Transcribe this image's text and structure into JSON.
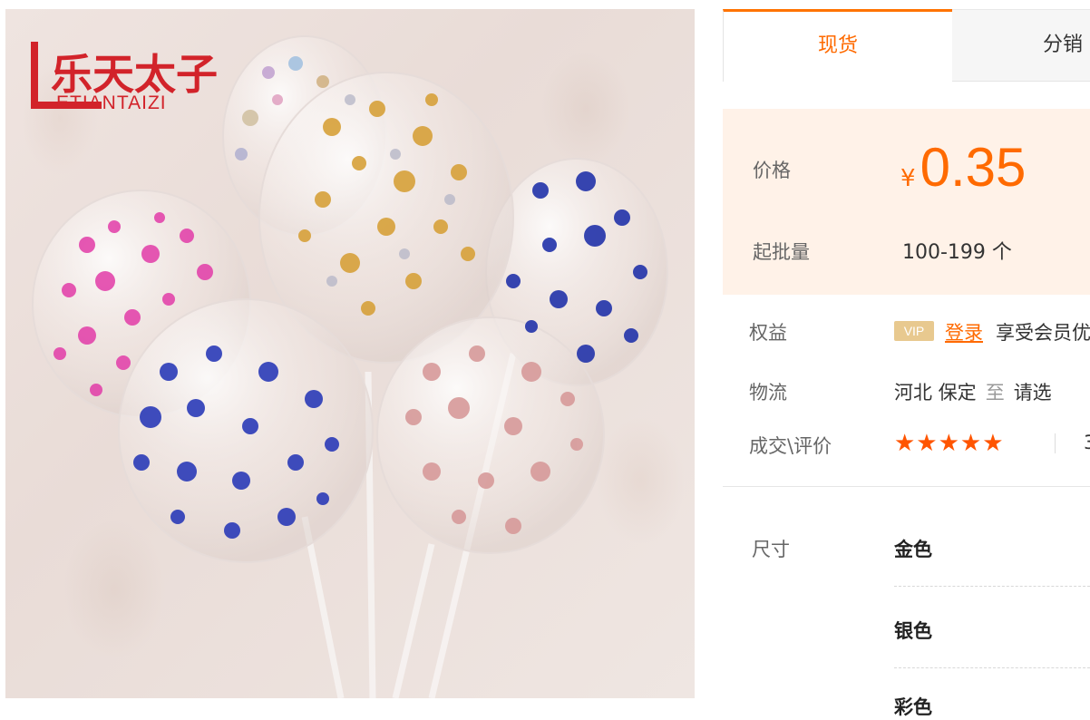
{
  "image": {
    "logo_cn": "乐天太子",
    "logo_en": "ETIANTAIZI",
    "logo_initial": "L"
  },
  "tabs": [
    {
      "label": "现货",
      "active": true
    },
    {
      "label": "分销",
      "active": false
    }
  ],
  "price": {
    "label": "价格",
    "currency": "¥",
    "amount": "0.35",
    "moq_label": "起批量",
    "moq_value": "100-199 个"
  },
  "benefits": {
    "label": "权益",
    "badge": "VIP",
    "login": "登录",
    "text": "享受会员优"
  },
  "logistics": {
    "label": "物流",
    "origin": "河北 保定",
    "to": "至",
    "dest": "请选"
  },
  "deals": {
    "label": "成交\\评价",
    "stars": "★★★★★",
    "rating": 5,
    "count": "3"
  },
  "size": {
    "label": "尺寸",
    "options": [
      "金色",
      "银色",
      "彩色"
    ]
  },
  "colors": {
    "accent": "#ff6a00",
    "panel_bg": "#fff2e8",
    "vip": "#e8c98f"
  }
}
